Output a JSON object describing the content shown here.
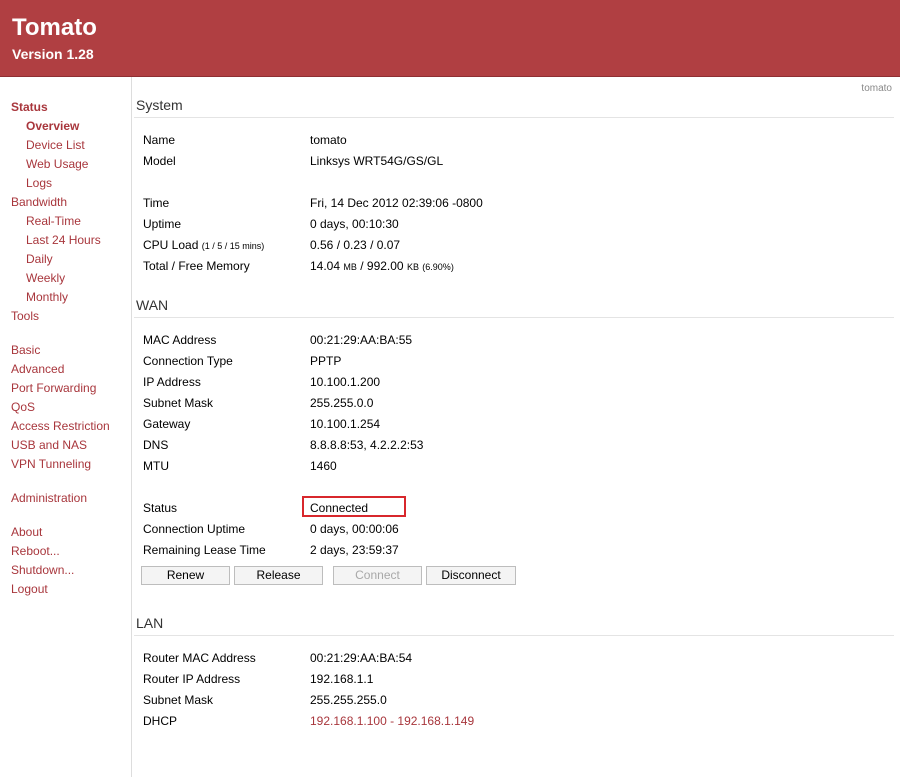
{
  "header": {
    "title": "Tomato",
    "version": "Version 1.28"
  },
  "hostname": "tomato",
  "sidebar": {
    "status": "Status",
    "overview": "Overview",
    "device_list": "Device List",
    "web_usage": "Web Usage",
    "logs": "Logs",
    "bandwidth": "Bandwidth",
    "realtime": "Real-Time",
    "last24": "Last 24 Hours",
    "daily": "Daily",
    "weekly": "Weekly",
    "monthly": "Monthly",
    "tools": "Tools",
    "basic": "Basic",
    "advanced": "Advanced",
    "port_forwarding": "Port Forwarding",
    "qos": "QoS",
    "access_restriction": "Access Restriction",
    "usb_nas": "USB and NAS",
    "vpn": "VPN Tunneling",
    "administration": "Administration",
    "about": "About",
    "reboot": "Reboot...",
    "shutdown": "Shutdown...",
    "logout": "Logout"
  },
  "system": {
    "title": "System",
    "name_label": "Name",
    "name": "tomato",
    "model_label": "Model",
    "model": "Linksys WRT54G/GS/GL",
    "time_label": "Time",
    "time": "Fri, 14 Dec 2012 02:39:06 -0800",
    "uptime_label": "Uptime",
    "uptime": "0 days, 00:10:30",
    "cpu_label": "CPU Load",
    "cpu_sub": "(1 / 5 / 15 mins)",
    "cpu_1": "0.56",
    "cpu_5": "0.23",
    "cpu_15": "0.07",
    "mem_label": "Total / Free Memory",
    "mem_total": "14.04",
    "mem_total_unit": "MB",
    "mem_free": "992.00",
    "mem_free_unit": "KB",
    "mem_pct": "(6.90%)"
  },
  "wan": {
    "title": "WAN",
    "mac_label": "MAC Address",
    "mac": "00:21:29:AA:BA:55",
    "type_label": "Connection Type",
    "type": "PPTP",
    "ip_label": "IP Address",
    "ip": "10.100.1.200",
    "subnet_label": "Subnet Mask",
    "subnet": "255.255.0.0",
    "gateway_label": "Gateway",
    "gateway": "10.100.1.254",
    "dns_label": "DNS",
    "dns": "8.8.8.8:53, 4.2.2.2:53",
    "mtu_label": "MTU",
    "mtu": "1460",
    "status_label": "Status",
    "status": "Connected",
    "conn_uptime_label": "Connection Uptime",
    "conn_uptime": "0 days, 00:00:06",
    "lease_label": "Remaining Lease Time",
    "lease": "2 days, 23:59:37",
    "buttons": {
      "renew": "Renew",
      "release": "Release",
      "connect": "Connect",
      "disconnect": "Disconnect"
    }
  },
  "lan": {
    "title": "LAN",
    "mac_label": "Router MAC Address",
    "mac": "00:21:29:AA:BA:54",
    "ip_label": "Router IP Address",
    "ip": "192.168.1.1",
    "subnet_label": "Subnet Mask",
    "subnet": "255.255.255.0",
    "dhcp_label": "DHCP",
    "dhcp": "192.168.1.100 - 192.168.1.149"
  },
  "colors": {
    "header": "#b03f42",
    "link": "#a8363c",
    "highlight": "#d8272c"
  }
}
